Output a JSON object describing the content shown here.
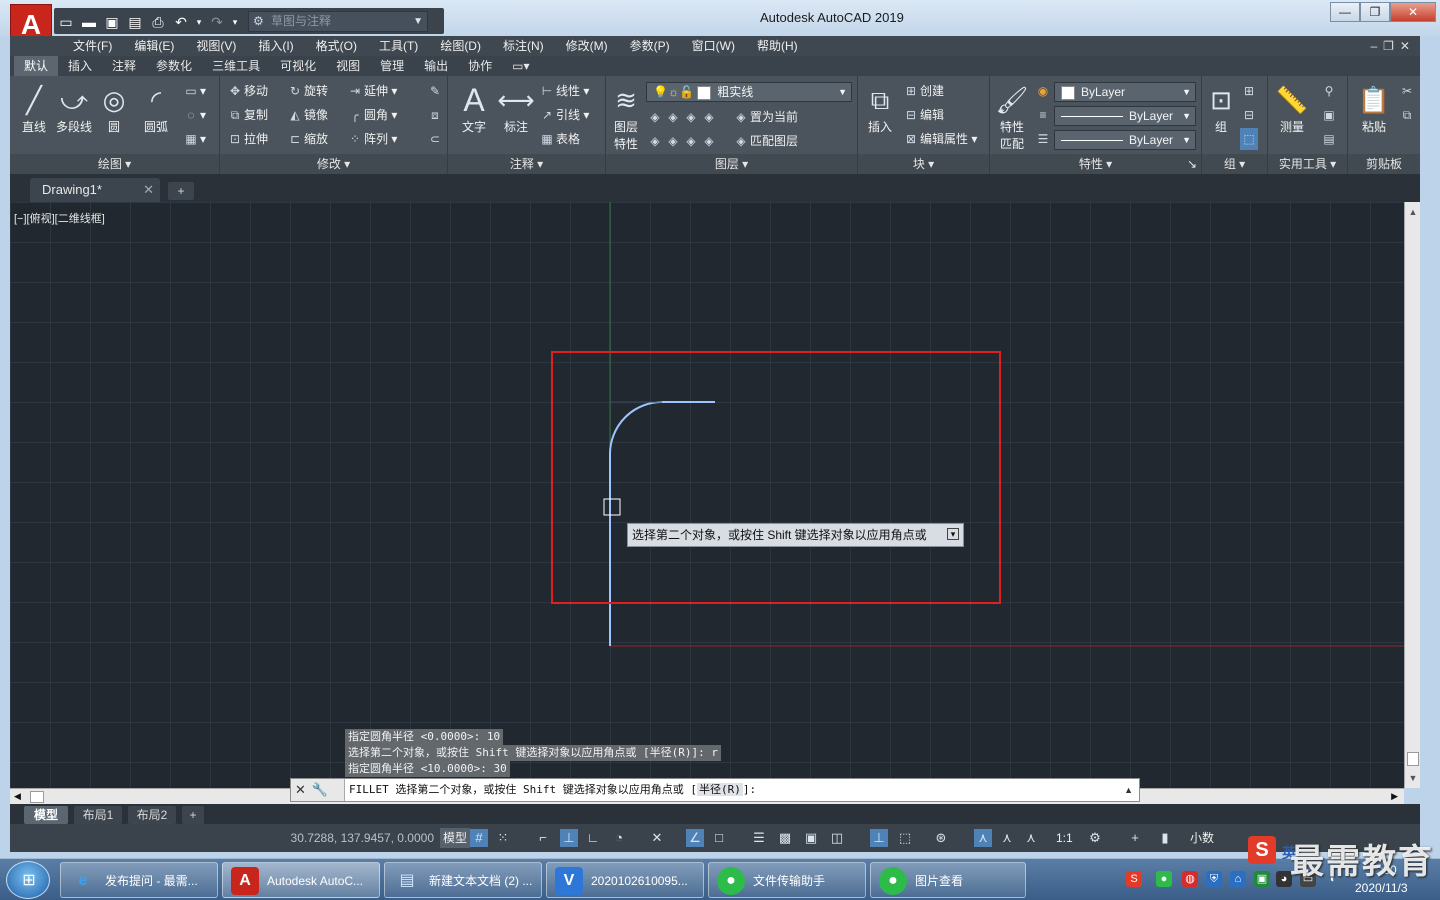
{
  "app": {
    "title": "Autodesk AutoCAD 2019",
    "logo_letter": "A",
    "workspace": "草图与注释"
  },
  "menu": [
    "文件(F)",
    "编辑(E)",
    "视图(V)",
    "插入(I)",
    "格式(O)",
    "工具(T)",
    "绘图(D)",
    "标注(N)",
    "修改(M)",
    "参数(P)",
    "窗口(W)",
    "帮助(H)"
  ],
  "ribbon_tabs": [
    "默认",
    "插入",
    "注释",
    "参数化",
    "三维工具",
    "可视化",
    "视图",
    "管理",
    "输出",
    "协作"
  ],
  "ribbon": {
    "draw": {
      "title": "绘图",
      "line": "直线",
      "polyline": "多段线",
      "circle": "圆",
      "arc": "圆弧"
    },
    "modify": {
      "title": "修改",
      "move": "移动",
      "rotate": "旋转",
      "extend": "延伸",
      "copy": "复制",
      "mirror": "镜像",
      "fillet": "圆角",
      "stretch": "拉伸",
      "scale": "缩放",
      "array": "阵列"
    },
    "annotation": {
      "title": "注释",
      "text": "文字",
      "dimension": "标注",
      "linear": "线性",
      "leader": "引线",
      "table": "表格"
    },
    "layers": {
      "title": "图层",
      "layer_props_line1": "图层",
      "layer_props_line2": "特性",
      "current_layer": "粗实线",
      "set_current": "置为当前",
      "match_layer": "匹配图层"
    },
    "block": {
      "title": "块",
      "insert": "插入",
      "create": "创建",
      "edit": "编辑",
      "edit_attr": "编辑属性"
    },
    "properties": {
      "title": "特性",
      "match_line1": "特性",
      "match_line2": "匹配",
      "color": "ByLayer",
      "linetype": "ByLayer",
      "lineweight": "ByLayer"
    },
    "groups": {
      "title": "组",
      "group": "组"
    },
    "utilities": {
      "title": "实用工具",
      "measure": "测量"
    },
    "clipboard": {
      "title": "剪贴板",
      "paste": "粘贴"
    }
  },
  "document": {
    "tab": "Drawing1*"
  },
  "viewport_label": "[−][俯视][二维线框]",
  "tooltip": "选择第二个对象，或按住 Shift 键选择对象以应用角点或",
  "command_history": [
    "指定圆角半径 <0.0000>: 10",
    "选择第二个对象，或按住 Shift 键选择对象以应用角点或 [半径(R)]: r",
    "指定圆角半径 <10.0000>: 30"
  ],
  "command_line": {
    "prefix": "FILLET 选择第二个对象，或按住 Shift 键选择对象以应用角点或 [",
    "option": "半径(R)",
    "suffix": "]:"
  },
  "layout_tabs": [
    "模型",
    "布局1",
    "布局2"
  ],
  "status": {
    "coords": "30.7288, 137.9457, 0.0000",
    "model": "模型",
    "scale": "1:1",
    "units": "小数"
  },
  "taskbar": {
    "tasks": [
      "发布提问 - 最需...",
      "Autodesk AutoC...",
      "新建文本文档 (2) ...",
      "2020102610095...",
      "文件传输助手",
      "图片查看"
    ],
    "ime": "英",
    "date": "2020/11/3",
    "time": ":30"
  },
  "watermark": "最需教育",
  "colors": {
    "canvas": "#212830",
    "highlight_box": "#e02020",
    "fillet_line": "#9ec4ff"
  }
}
